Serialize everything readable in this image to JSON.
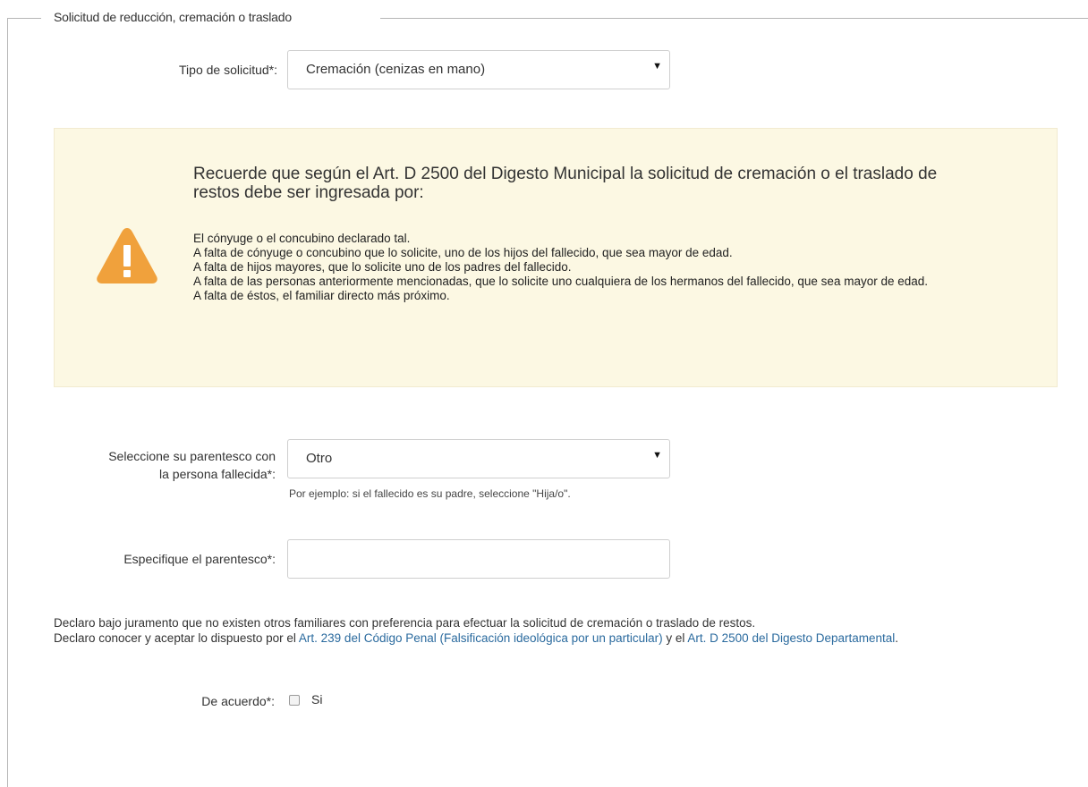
{
  "fieldset": {
    "legend": "Solicitud de reducción, cremación o traslado"
  },
  "tipo_solicitud": {
    "label": "Tipo de solicitud*:",
    "selected": "Cremación (cenizas en mano)"
  },
  "warning": {
    "icon": "warning-triangle-icon",
    "color": "#f0a13c",
    "title": "Recuerde que según el Art. D 2500 del Digesto Municipal la solicitud de cremación o el traslado de restos debe ser ingresada por:",
    "items": [
      "El cónyuge o el concubino declarado tal.",
      "A falta de cónyuge o concubino que lo solicite, uno de los hijos del fallecido, que sea mayor de edad.",
      "A falta de hijos mayores, que lo solicite uno de los padres del fallecido.",
      "A falta de las personas anteriormente mencionadas, que lo solicite uno cualquiera de los hermanos del fallecido, que sea mayor de edad.",
      "A falta de éstos, el familiar directo más próximo."
    ]
  },
  "parentesco": {
    "label_line1": "Seleccione su parentesco con",
    "label_line2": "la persona fallecida*:",
    "selected": "Otro",
    "help": "Por ejemplo: si el fallecido es su padre, seleccione \"Hija/o\"."
  },
  "especifique": {
    "label": "Especifique el parentesco*:",
    "value": ""
  },
  "declaracion": {
    "line1": "Declaro bajo juramento que no existen otros familiares con preferencia para efectuar la solicitud de cremación o traslado de restos.",
    "line2_prefix": "Declaro conocer y aceptar lo dispuesto por el ",
    "link1": "Art. 239 del Código Penal (Falsificación ideológica por un particular)",
    "line2_middle": " y el ",
    "link2": "Art. D 2500 del Digesto Departamental",
    "line2_suffix": "."
  },
  "acuerdo": {
    "label": "De acuerdo*:",
    "option": "Si",
    "checked": false
  }
}
